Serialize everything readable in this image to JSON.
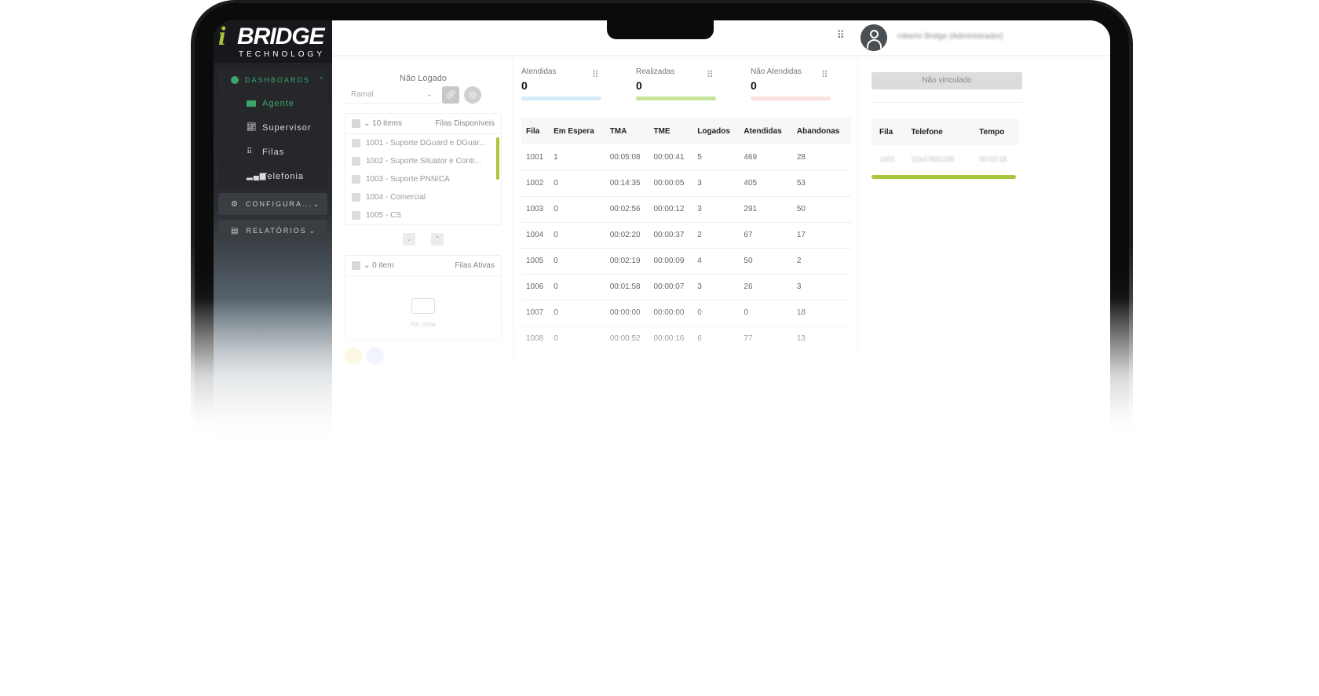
{
  "logo": {
    "i": "i",
    "brand": "BRIDGE",
    "sub": "TECHNOLOGY"
  },
  "sidebar": {
    "dashboards": {
      "label": "DASHBOARDS",
      "icon": "gauge-icon"
    },
    "items": [
      {
        "label": "Agente",
        "icon": "card-icon",
        "active": true
      },
      {
        "label": "Supervisor",
        "icon": "line-chart-icon"
      },
      {
        "label": "Filas",
        "icon": "grid-icon"
      },
      {
        "label": "Telefonia",
        "icon": "signal-icon"
      }
    ],
    "configuracoes": {
      "label": "CONFIGURA...",
      "icon": "gear-icon"
    },
    "relatorios": {
      "label": "RELATÓRIOS",
      "icon": "document-icon"
    }
  },
  "topbar": {
    "username": "roberto Bridge (Administrador)"
  },
  "agent": {
    "status": "Não Logado",
    "ramal_placeholder": "Ramal",
    "available": {
      "count_label": "10 items",
      "title": "Filas Disponíveis",
      "items": [
        "1001 - Suporte DGuard e DGuar...",
        "1002 - Suporte Situator e Contr...",
        "1003 - Suporte PNN/CA",
        "1004 - Comercial",
        "1005 - CS"
      ]
    },
    "active": {
      "count_label": "0 item",
      "title": "Filas Ativas",
      "empty": "No data"
    }
  },
  "kpis": [
    {
      "label": "Atendidas",
      "value": "0",
      "color": "#d6ecfb"
    },
    {
      "label": "Realizadas",
      "value": "0",
      "color": "#c5e59a"
    },
    {
      "label": "Não Atendidas",
      "value": "0",
      "color": "#fbe0e0"
    }
  ],
  "queue_table": {
    "headers": [
      "Fila",
      "Em Espera",
      "TMA",
      "TME",
      "Logados",
      "Atendidas",
      "Abandonas"
    ],
    "rows": [
      [
        "1001",
        "1",
        "00:05:08",
        "00:00:41",
        "5",
        "469",
        "28"
      ],
      [
        "1002",
        "0",
        "00:14:35",
        "00:00:05",
        "3",
        "405",
        "53"
      ],
      [
        "1003",
        "0",
        "00:02:56",
        "00:00:12",
        "3",
        "291",
        "50"
      ],
      [
        "1004",
        "0",
        "00:02:20",
        "00:00:37",
        "2",
        "67",
        "17"
      ],
      [
        "1005",
        "0",
        "00:02:19",
        "00:00:09",
        "4",
        "50",
        "2"
      ],
      [
        "1006",
        "0",
        "00:01:58",
        "00:00:07",
        "3",
        "26",
        "3"
      ],
      [
        "1007",
        "0",
        "00:00:00",
        "00:00:00",
        "0",
        "0",
        "18"
      ],
      [
        "1008",
        "0",
        "00:00:52",
        "00:00:16",
        "6",
        "77",
        "13"
      ]
    ]
  },
  "calls": {
    "button": "Não vinculado",
    "headers": [
      "Fila",
      "Telefone",
      "Tempo"
    ],
    "row": [
      "1001",
      "11647892228",
      "00:03:18"
    ]
  },
  "colors": {
    "accent": "#a9c63c",
    "menu_active": "#3ea56a"
  }
}
